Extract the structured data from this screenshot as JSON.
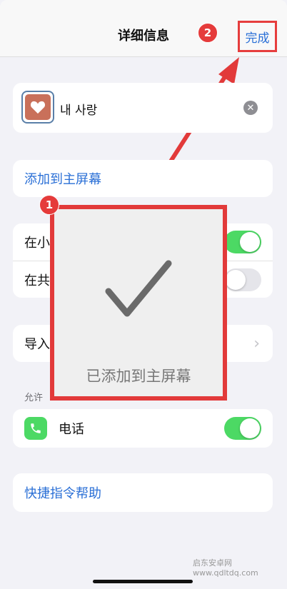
{
  "header": {
    "title": "详细信息",
    "done_label": "完成"
  },
  "annotations": {
    "step1": "1",
    "step2": "2"
  },
  "shortcut": {
    "name": "내 사랑",
    "icon": "heart-icon"
  },
  "add_to_home_label": "添加到主屏幕",
  "settings": {
    "row1_label": "在小",
    "row1_toggle": "on",
    "row2_label": "在共",
    "row2_toggle": "off",
    "import_label": "导入"
  },
  "allow": {
    "section_label": "允许",
    "phone_label": "电话",
    "phone_toggle": "on"
  },
  "help_label": "快捷指令帮助",
  "hud": {
    "message": "已添加到主屏幕",
    "icon": "checkmark-icon"
  },
  "watermark": "启东安卓网 www.qdltdq.com",
  "colors": {
    "accent": "#2a6fd6",
    "annotation": "#e23a3a",
    "toggle_on": "#4cd964"
  }
}
